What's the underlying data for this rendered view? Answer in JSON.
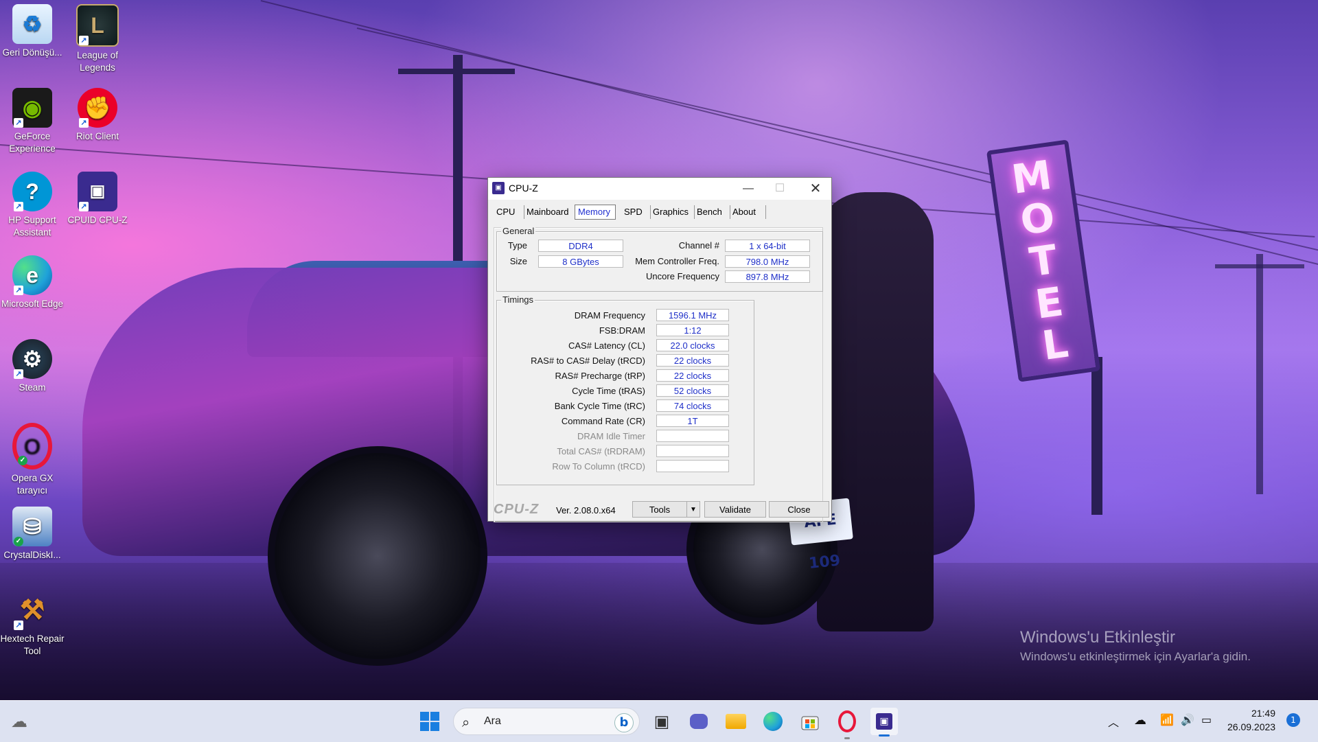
{
  "desktop": {
    "icons": [
      {
        "label": "Geri Dönüşü...",
        "icon": "recycle-bin-icon",
        "color": "#ffffff"
      },
      {
        "label": "League of Legends",
        "icon": "league-of-legends-icon",
        "color": "#c8aa6e"
      },
      {
        "label": "GeForce Experience",
        "icon": "geforce-icon",
        "color": "#76b900"
      },
      {
        "label": "Riot Client",
        "icon": "riot-client-icon",
        "color": "#eb0029"
      },
      {
        "label": "HP Support Assistant",
        "icon": "hp-support-icon",
        "color": "#0096d6"
      },
      {
        "label": "CPUID CPU-Z",
        "icon": "cpuz-icon",
        "color": "#3a2b8f"
      },
      {
        "label": "Microsoft Edge",
        "icon": "edge-icon",
        "color": "#1fa2d9"
      },
      {
        "label": "Steam",
        "icon": "steam-icon",
        "color": "#1b2838"
      },
      {
        "label": "Opera GX tarayıcı",
        "icon": "opera-gx-icon",
        "color": "#e8173a"
      },
      {
        "label": "CrystalDiskI...",
        "icon": "crystaldiskinfo-icon",
        "color": "#4e82c4"
      },
      {
        "label": "Hextech Repair Tool",
        "icon": "hextech-icon",
        "color": "#c58a2a"
      }
    ],
    "motel_sign": [
      "M",
      "O",
      "T",
      "E",
      "L"
    ],
    "plate": "AFE 109",
    "watermark": {
      "title": "Windows'u Etkinleştir",
      "subtitle": "Windows'u etkinleştirmek için Ayarlar'a gidin."
    }
  },
  "cpuz": {
    "title": "CPU-Z",
    "tabs": [
      "CPU",
      "Mainboard",
      "Memory",
      "SPD",
      "Graphics",
      "Bench",
      "About"
    ],
    "active_tab": "Memory",
    "general": {
      "legend": "General",
      "type_label": "Type",
      "type_value": "DDR4",
      "size_label": "Size",
      "size_value": "8 GBytes",
      "channel_label": "Channel #",
      "channel_value": "1 x 64-bit",
      "mcf_label": "Mem Controller Freq.",
      "mcf_value": "798.0 MHz",
      "uncore_label": "Uncore Frequency",
      "uncore_value": "897.8 MHz"
    },
    "timings": {
      "legend": "Timings",
      "rows": [
        {
          "label": "DRAM Frequency",
          "value": "1596.1 MHz",
          "enabled": true
        },
        {
          "label": "FSB:DRAM",
          "value": "1:12",
          "enabled": true
        },
        {
          "label": "CAS# Latency (CL)",
          "value": "22.0 clocks",
          "enabled": true
        },
        {
          "label": "RAS# to CAS# Delay (tRCD)",
          "value": "22 clocks",
          "enabled": true
        },
        {
          "label": "RAS# Precharge (tRP)",
          "value": "22 clocks",
          "enabled": true
        },
        {
          "label": "Cycle Time (tRAS)",
          "value": "52 clocks",
          "enabled": true
        },
        {
          "label": "Bank Cycle Time (tRC)",
          "value": "74 clocks",
          "enabled": true
        },
        {
          "label": "Command Rate (CR)",
          "value": "1T",
          "enabled": true
        },
        {
          "label": "DRAM Idle Timer",
          "value": "",
          "enabled": false
        },
        {
          "label": "Total CAS# (tRDRAM)",
          "value": "",
          "enabled": false
        },
        {
          "label": "Row To Column (tRCD)",
          "value": "",
          "enabled": false
        }
      ]
    },
    "footer": {
      "logo": "CPU-Z",
      "version": "Ver. 2.08.0.x64",
      "tools": "Tools",
      "validate": "Validate",
      "close": "Close"
    }
  },
  "taskbar": {
    "search_placeholder": "Ara",
    "time": "21:49",
    "date": "26.09.2023",
    "notification_count": "1"
  }
}
